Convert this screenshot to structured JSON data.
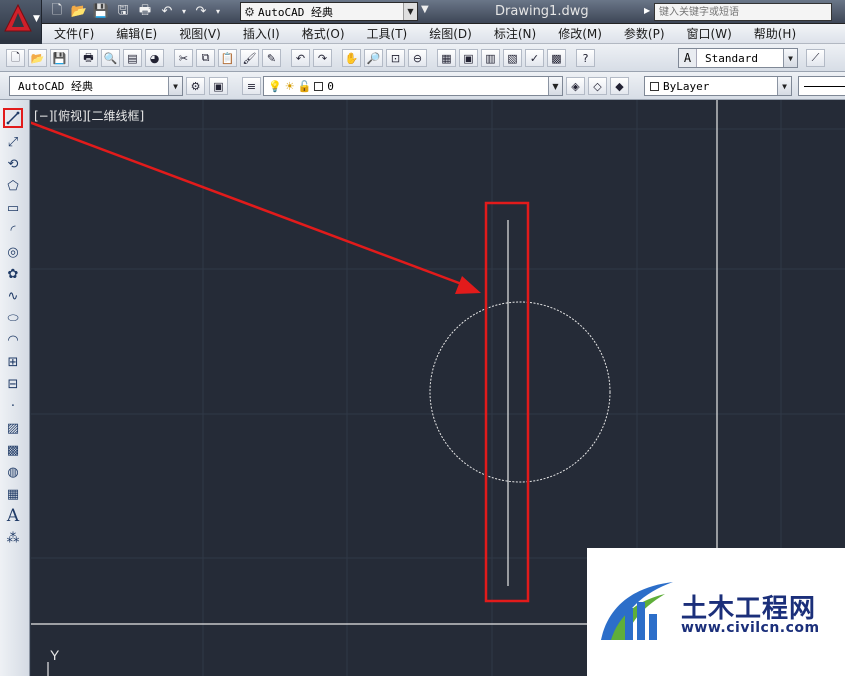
{
  "titlebar": {
    "workspace": "AutoCAD 经典",
    "document_title": "Drawing1.dwg",
    "search_placeholder": "键入关键字或短语"
  },
  "menu": [
    "文件(F)",
    "编辑(E)",
    "视图(V)",
    "插入(I)",
    "格式(O)",
    "工具(T)",
    "绘图(D)",
    "标注(N)",
    "修改(M)",
    "参数(P)",
    "窗口(W)",
    "帮助(H)"
  ],
  "toolbar1": {
    "text_style": "Standard"
  },
  "toolbar2": {
    "workspace": "AutoCAD 经典",
    "layer_name": "0",
    "color": "ByLayer"
  },
  "left_toolbar": {
    "highlighted_tool": "line-icon",
    "tools": [
      "line-icon",
      "construction-line-icon",
      "polyline-icon",
      "polygon-icon",
      "rectangle-icon",
      "arc-icon",
      "circle-icon",
      "revision-cloud-icon",
      "spline-icon",
      "ellipse-icon",
      "ellipse-arc-icon",
      "insert-block-icon",
      "make-block-icon",
      "point-icon",
      "hatch-icon",
      "gradient-icon",
      "region-icon",
      "table-icon",
      "multiline-text-icon",
      "add-selected-icon"
    ],
    "text_tool_glyph": "A"
  },
  "canvas": {
    "viewport_label": "[−][俯视][二维线框]",
    "ucs_axis_label": "Y",
    "background": "#252b37",
    "highlight_color": "#e21b1b"
  },
  "watermark": {
    "title": "土木工程网",
    "url": "www.civilcn.com"
  }
}
